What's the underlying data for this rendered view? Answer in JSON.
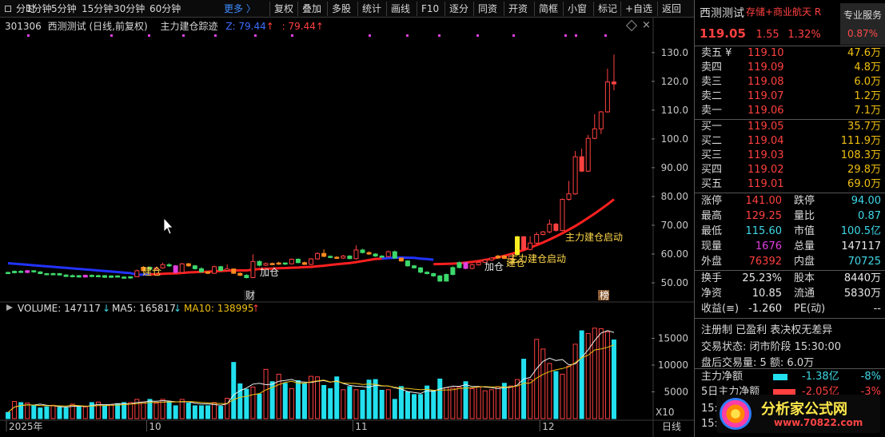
{
  "toolbar": {
    "periods": [
      "分时",
      "1分钟",
      "5分钟",
      "15分钟",
      "30分钟",
      "60分钟"
    ],
    "more": "更多 〉",
    "tools": [
      "复权",
      "叠加",
      "多股",
      "统计",
      "画线",
      "F10",
      "逐分",
      "同资",
      "开资",
      "简框",
      "小窗",
      "标记",
      "+自选",
      "返回"
    ]
  },
  "header": {
    "code": "301306",
    "title": "西测测试 (日线,前复权)",
    "indicator": "主力建仓踪迹",
    "v1": "Z: 79.44",
    "arrow1": "↑",
    "v2": ": 79.44",
    "arrow2": "↑"
  },
  "price_axis": [
    "130.0",
    "120.0",
    "110.0",
    "100.0",
    "90.00",
    "80.00",
    "70.00",
    "60.00",
    "50.00"
  ],
  "chart_labels": {
    "jc1": "建仓",
    "jc2": "建仓",
    "jc3": "建仓",
    "add1": "加仓",
    "add2": "加仓",
    "start1": "主力建仓启动",
    "start2": "主力建仓启动",
    "cai": "财",
    "bang": "榜"
  },
  "volume_header": {
    "label": "VOLUME: 147117",
    "a1": "↓",
    "ma5": "MA5: 165817",
    "a2": "↓",
    "ma10": "MA10: 138995",
    "a3": "↑"
  },
  "volume_axis": [
    "15000",
    "10000",
    "5000"
  ],
  "volume_unit": "X10",
  "dates": [
    "2025年",
    "10",
    "11",
    "12"
  ],
  "period_btn": "日线",
  "chart_data": {
    "type": "candlestick",
    "price_ylim": [
      45,
      133
    ],
    "volume_ylim": [
      0,
      18500
    ],
    "candles": [
      [
        53.6,
        53.5,
        53.2,
        53.9
      ],
      [
        53.5,
        54.0,
        53.2,
        54.3
      ],
      [
        54.0,
        53.6,
        53.4,
        54.4
      ],
      [
        53.6,
        54.2,
        53.3,
        54.5
      ],
      [
        54.2,
        53.8,
        53.5,
        54.4
      ],
      [
        53.8,
        53.2,
        53.0,
        54.0
      ],
      [
        53.2,
        52.9,
        52.7,
        53.4
      ],
      [
        52.9,
        53.2,
        52.6,
        53.5
      ],
      [
        53.2,
        52.7,
        52.5,
        53.4
      ],
      [
        52.7,
        52.2,
        52.0,
        53.0
      ],
      [
        52.2,
        52.5,
        51.9,
        52.9
      ],
      [
        52.5,
        52.0,
        51.8,
        52.7
      ],
      [
        52.0,
        52.6,
        51.8,
        52.9
      ],
      [
        52.6,
        52.2,
        51.9,
        52.9
      ],
      [
        52.2,
        52.5,
        51.9,
        52.8
      ],
      [
        52.5,
        51.9,
        51.7,
        52.7
      ],
      [
        51.9,
        52.4,
        51.7,
        52.6
      ],
      [
        52.4,
        52.0,
        51.8,
        52.6
      ],
      [
        52.0,
        51.7,
        51.5,
        52.3
      ],
      [
        51.7,
        52.1,
        51.4,
        52.3
      ],
      [
        52.1,
        54.2,
        52.0,
        54.6
      ],
      [
        54.2,
        55.4,
        53.8,
        55.8
      ],
      [
        55.4,
        54.7,
        54.4,
        55.7
      ],
      [
        54.7,
        55.2,
        54.3,
        55.6
      ],
      [
        55.2,
        56.3,
        54.9,
        57.0
      ],
      [
        56.3,
        55.9,
        55.5,
        56.8
      ],
      [
        55.9,
        53.6,
        53.3,
        56.2
      ],
      [
        53.6,
        56.6,
        53.4,
        56.9
      ],
      [
        56.6,
        55.9,
        55.6,
        56.9
      ],
      [
        55.9,
        54.9,
        54.6,
        56.2
      ],
      [
        54.9,
        53.8,
        53.5,
        55.4
      ],
      [
        53.8,
        53.3,
        53.0,
        54.1
      ],
      [
        53.3,
        55.6,
        53.1,
        56.0
      ],
      [
        55.6,
        54.3,
        54.0,
        55.9
      ],
      [
        54.3,
        54.8,
        54.0,
        56.4
      ],
      [
        54.8,
        53.3,
        53.1,
        55.0
      ],
      [
        53.3,
        52.6,
        52.4,
        53.6
      ],
      [
        52.6,
        51.8,
        51.5,
        53.0
      ],
      [
        51.8,
        57.4,
        51.6,
        59.9
      ],
      [
        57.4,
        56.1,
        55.7,
        57.8
      ],
      [
        56.1,
        56.7,
        55.8,
        57.1
      ],
      [
        56.7,
        56.5,
        56.3,
        57.0
      ],
      [
        56.5,
        56.9,
        56.2,
        57.3
      ],
      [
        56.9,
        56.6,
        56.2,
        57.1
      ],
      [
        56.6,
        58.2,
        56.3,
        58.5
      ],
      [
        58.2,
        57.0,
        56.8,
        58.5
      ],
      [
        57.0,
        56.4,
        56.2,
        57.4
      ],
      [
        56.4,
        58.3,
        56.1,
        58.6
      ],
      [
        58.3,
        60.2,
        58.0,
        60.6
      ],
      [
        60.2,
        59.2,
        58.9,
        61.6
      ],
      [
        59.2,
        58.9,
        58.6,
        59.5
      ],
      [
        58.9,
        58.6,
        58.3,
        59.2
      ],
      [
        58.6,
        59.3,
        58.3,
        59.7
      ],
      [
        59.3,
        58.4,
        58.2,
        59.6
      ],
      [
        58.4,
        61.4,
        58.1,
        63.0
      ],
      [
        61.4,
        60.5,
        60.2,
        61.8
      ],
      [
        60.5,
        60.0,
        59.7,
        60.9
      ],
      [
        60.0,
        59.3,
        59.0,
        60.3
      ],
      [
        59.3,
        59.1,
        58.8,
        59.6
      ],
      [
        59.1,
        60.8,
        58.9,
        61.2
      ],
      [
        60.8,
        58.6,
        58.3,
        61.2
      ],
      [
        58.6,
        57.6,
        57.3,
        58.8
      ],
      [
        57.6,
        55.9,
        55.6,
        57.9
      ],
      [
        55.9,
        55.2,
        54.9,
        56.2
      ],
      [
        55.2,
        53.7,
        53.3,
        55.5
      ],
      [
        53.7,
        53.2,
        52.9,
        54.0
      ],
      [
        53.2,
        52.4,
        52.1,
        53.5
      ],
      [
        52.4,
        50.6,
        50.3,
        52.7
      ],
      [
        50.6,
        52.9,
        50.4,
        53.2
      ],
      [
        52.9,
        55.3,
        52.6,
        55.7
      ],
      [
        55.3,
        57.0,
        55.0,
        57.4
      ],
      [
        57.0,
        55.0,
        54.7,
        57.3
      ],
      [
        55.0,
        56.3,
        54.7,
        56.7
      ],
      [
        56.3,
        57.1,
        56.0,
        57.5
      ],
      [
        57.1,
        57.9,
        56.9,
        58.4
      ],
      [
        57.9,
        58.6,
        57.6,
        58.9
      ],
      [
        58.6,
        59.3,
        58.3,
        59.7
      ],
      [
        59.3,
        58.5,
        58.2,
        59.6
      ],
      [
        58.5,
        59.8,
        58.2,
        60.3
      ],
      [
        59.8,
        66.0,
        59.5,
        66.3
      ],
      [
        66.0,
        61.6,
        61.3,
        66.3
      ],
      [
        61.6,
        63.8,
        61.3,
        66.2
      ],
      [
        63.8,
        66.8,
        63.5,
        67.6
      ],
      [
        66.8,
        67.7,
        66.5,
        68.0
      ],
      [
        67.7,
        70.4,
        67.2,
        72.0
      ],
      [
        70.4,
        68.2,
        67.8,
        70.8
      ],
      [
        68.2,
        79.0,
        67.9,
        79.3
      ],
      [
        79.0,
        80.9,
        78.6,
        85.4
      ],
      [
        80.9,
        93.8,
        80.6,
        95.8
      ],
      [
        93.8,
        88.8,
        88.5,
        96.6
      ],
      [
        88.8,
        100.2,
        88.5,
        101.4
      ],
      [
        100.2,
        103.5,
        99.9,
        108.6
      ],
      [
        103.5,
        109.4,
        101.7,
        109.7
      ],
      [
        109.4,
        119.8,
        109.1,
        124.4
      ],
      [
        119.8,
        119.1,
        116.9,
        129.3
      ]
    ],
    "volume": [
      1150,
      3200,
      3000,
      2900,
      2400,
      2000,
      2200,
      2500,
      2100,
      2000,
      2700,
      2300,
      2200,
      3000,
      3100,
      2400,
      2600,
      2800,
      3000,
      3000,
      3600,
      3100,
      3600,
      2900,
      3600,
      3200,
      2400,
      3600,
      2900,
      2400,
      2400,
      2400,
      3000,
      2300,
      3800,
      10500,
      6500,
      5500,
      5900,
      4600,
      9200,
      6900,
      8300,
      6600,
      5600,
      7100,
      6500,
      7900,
      7800,
      6200,
      5600,
      7800,
      5400,
      6000,
      5400,
      5300,
      7200,
      7300,
      5300,
      5400,
      3600,
      6000,
      5000,
      4500,
      4500,
      6100,
      5300,
      7400,
      5800,
      5700,
      5900,
      6900,
      5600,
      5900,
      5200,
      5400,
      5900,
      6600,
      6100,
      7300,
      11100,
      7300,
      14800,
      13000,
      10300,
      8800,
      8300,
      9800,
      13900,
      16400,
      15900,
      16900,
      16800,
      16200,
      14700
    ]
  },
  "panel": {
    "name": "西测测试",
    "tag": "存储+商业航天 R",
    "price": "119.05",
    "chg": "1.55",
    "pct": "1.32%",
    "svc": "专业服务",
    "svc_pct": "0.87%",
    "asks": [
      [
        "卖五 ¥",
        "119.10",
        "47.6万"
      ],
      [
        "卖四",
        "119.09",
        "4.8万"
      ],
      [
        "卖三",
        "119.08",
        "6.0万"
      ],
      [
        "卖二",
        "119.07",
        "1.2万"
      ],
      [
        "卖一",
        "119.06",
        "7.1万"
      ]
    ],
    "bids": [
      [
        "买一",
        "119.05",
        "35.7万"
      ],
      [
        "买二",
        "119.04",
        "111.9万"
      ],
      [
        "买三",
        "119.03",
        "108.3万"
      ],
      [
        "买四",
        "119.02",
        "29.8万"
      ],
      [
        "买五",
        "119.01",
        "69.0万"
      ]
    ],
    "q1": [
      [
        "涨停",
        "141.00",
        "跌停",
        "94.00"
      ],
      [
        "最高",
        "129.25",
        "量比",
        "0.87"
      ],
      [
        "最低",
        "115.60",
        "市值",
        "100.5亿"
      ],
      [
        "现量",
        "1676",
        "总量",
        "147117"
      ],
      [
        "外盘",
        "76392",
        "内盘",
        "70725"
      ]
    ],
    "q2": [
      [
        "换手",
        "25.23%",
        "股本",
        "8440万"
      ],
      [
        "净资",
        "10.85",
        "流通",
        "5830万"
      ],
      [
        "收益(≡)",
        "-1.260",
        "PE(动)",
        "--"
      ]
    ],
    "reg": "注册制 已盈利 表决权无差异",
    "status": "交易状态: 闭市阶段 15:30:00",
    "after": "盘后交易量: 5  额: 6.0万",
    "flow1": [
      "主力净额",
      "-1.38亿",
      "-8%"
    ],
    "flow2": [
      "5日主力净额",
      "-2.05亿",
      "-3%"
    ],
    "misc": [
      "15:",
      "15:"
    ],
    "watermark": "分析家公式网",
    "watermark_url": "www.70822.com"
  }
}
